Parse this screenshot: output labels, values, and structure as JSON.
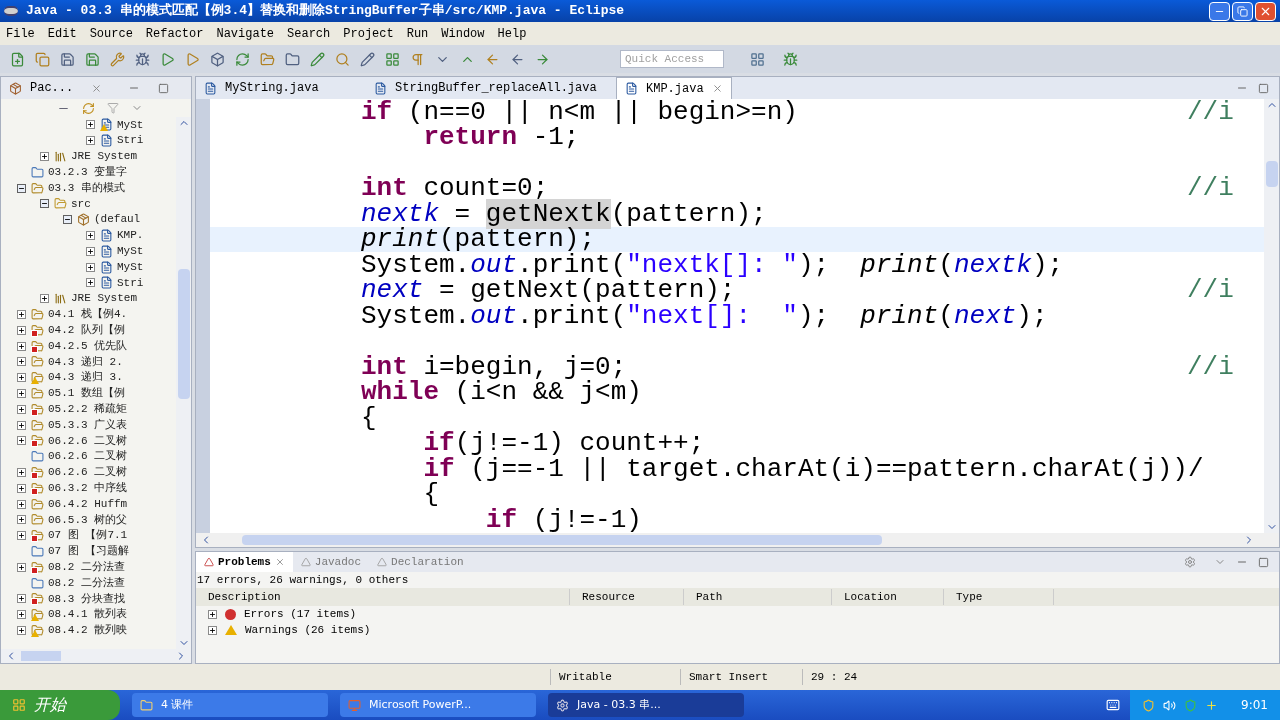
{
  "window": {
    "title": "Java - 03.3  串的模式匹配【例3.4】替换和删除StringBuffer子串/src/KMP.java - Eclipse"
  },
  "menu": [
    "File",
    "Edit",
    "Source",
    "Refactor",
    "Navigate",
    "Search",
    "Project",
    "Run",
    "Window",
    "Help"
  ],
  "quick_access": {
    "placeholder": "Quick Access"
  },
  "explorer": {
    "title": "Pac...",
    "tree": [
      {
        "children": [
          {
            "children": [
              {
                "children": [
                  {
                    "label": "MySt",
                    "kind": "file",
                    "expanded": false,
                    "error": false,
                    "warning": true
                  },
                  {
                    "label": "Stri",
                    "kind": "file",
                    "expanded": false,
                    "error": false,
                    "warning": false
                  }
                ]
              }
            ]
          },
          {
            "label": "JRE System",
            "kind": "library",
            "expanded": false,
            "error": false,
            "warning": false
          }
        ]
      },
      {
        "label": "03.2.3  变量字",
        "kind": "folder",
        "error": false,
        "warning": false
      },
      {
        "label": "03.3  串的模式",
        "kind": "project",
        "expanded": true,
        "error": false,
        "warning": false,
        "children": [
          {
            "label": "src",
            "kind": "source",
            "expanded": true,
            "error": false,
            "warning": false,
            "children": [
              {
                "label": "(defaul",
                "kind": "package",
                "expanded": true,
                "error": false,
                "warning": false,
                "children": [
                  {
                    "label": "KMP.",
                    "kind": "file",
                    "expanded": false,
                    "error": false,
                    "warning": false
                  },
                  {
                    "label": "MySt",
                    "kind": "file",
                    "expanded": false,
                    "error": false,
                    "warning": false
                  },
                  {
                    "label": "MySt",
                    "kind": "file",
                    "expanded": false,
                    "error": false,
                    "warning": false
                  },
                  {
                    "label": "Stri",
                    "kind": "file",
                    "expanded": false,
                    "error": false,
                    "warning": false
                  }
                ]
              }
            ]
          },
          {
            "label": "JRE System",
            "kind": "library",
            "expanded": false,
            "error": false,
            "warning": false
          }
        ]
      },
      {
        "label": "04.1  栈【例4.",
        "kind": "project",
        "expanded": false,
        "error": false,
        "warning": false
      },
      {
        "label": "04.2  队列【例",
        "kind": "project",
        "expanded": false,
        "error": true,
        "warning": false
      },
      {
        "label": "04.2.5  优先队",
        "kind": "project",
        "expanded": false,
        "error": true,
        "warning": false
      },
      {
        "label": "04.3  递归 2.",
        "kind": "project",
        "expanded": false,
        "error": false,
        "warning": false
      },
      {
        "label": "04.3  递归 3.",
        "kind": "project",
        "expanded": false,
        "error": false,
        "warning": true
      },
      {
        "label": "05.1  数组【例",
        "kind": "project",
        "expanded": false,
        "error": false,
        "warning": false
      },
      {
        "label": "05.2.2  稀疏矩",
        "kind": "project",
        "expanded": false,
        "error": true,
        "warning": false
      },
      {
        "label": "05.3.3  广义表",
        "kind": "project",
        "expanded": false,
        "error": false,
        "warning": false
      },
      {
        "label": "06.2.6  二叉树",
        "kind": "project",
        "expanded": false,
        "error": true,
        "warning": false
      },
      {
        "label": "06.2.6  二叉树",
        "kind": "folder",
        "error": false,
        "warning": false
      },
      {
        "label": "06.2.6  二叉树",
        "kind": "project",
        "expanded": false,
        "error": true,
        "warning": false
      },
      {
        "label": "06.3.2  中序线",
        "kind": "project",
        "expanded": false,
        "error": true,
        "warning": false
      },
      {
        "label": "06.4.2  Huffm",
        "kind": "project",
        "expanded": false,
        "error": false,
        "warning": false
      },
      {
        "label": "06.5.3  树的父",
        "kind": "project",
        "expanded": false,
        "error": false,
        "warning": false
      },
      {
        "label": "07  图 【例7.1",
        "kind": "project",
        "expanded": false,
        "error": true,
        "warning": false
      },
      {
        "label": "07 图 【习题解",
        "kind": "folder",
        "error": false,
        "warning": false
      },
      {
        "label": "08.2  二分法查",
        "kind": "project",
        "expanded": false,
        "error": true,
        "warning": false
      },
      {
        "label": "08.2  二分法查",
        "kind": "folder",
        "error": false,
        "warning": false
      },
      {
        "label": "08.3  分块查找",
        "kind": "project",
        "expanded": false,
        "error": true,
        "warning": false
      },
      {
        "label": "08.4.1  散列表",
        "kind": "project",
        "expanded": false,
        "error": false,
        "warning": true
      },
      {
        "label": "08.4.2  散列映",
        "kind": "project",
        "expanded": false,
        "error": false,
        "warning": true
      }
    ]
  },
  "editor_tabs": [
    {
      "label": "MyString.java",
      "selected": false
    },
    {
      "label": "StringBuffer_replaceAll.java",
      "selected": false
    },
    {
      "label": "KMP.java",
      "selected": true
    }
  ],
  "code": [
    {
      "current": false,
      "segments": [
        {
          "kind": "kw",
          "text": "if"
        },
        {
          "kind": "plain",
          "text": " (n==0 || n<m || begin>=n)"
        }
      ],
      "comment": "//i"
    },
    {
      "current": false,
      "segments": [
        {
          "kind": "kw",
          "text": "    return"
        },
        {
          "kind": "plain",
          "text": " -1;"
        }
      ]
    },
    {
      "current": false
    },
    {
      "current": false,
      "segments": [
        {
          "kind": "kw",
          "text": "int"
        },
        {
          "kind": "plain",
          "text": " count=0;"
        }
      ],
      "comment": "//i"
    },
    {
      "current": false,
      "segments": [
        {
          "kind": "field",
          "text": "nextk"
        },
        {
          "kind": "plain",
          "text": " = "
        },
        {
          "kind": "occurrence",
          "text": "getNextk"
        },
        {
          "kind": "plain",
          "text": "(pattern);"
        }
      ]
    },
    {
      "current": true,
      "segments": [
        {
          "kind": "static",
          "text": "print"
        },
        {
          "kind": "plain",
          "text": "(pattern);"
        }
      ]
    },
    {
      "current": false,
      "segments": [
        {
          "kind": "plain",
          "text": "System."
        },
        {
          "kind": "field",
          "text": "out"
        },
        {
          "kind": "plain",
          "text": ".print("
        },
        {
          "kind": "str",
          "text": "\"nextk[]: \""
        },
        {
          "kind": "plain",
          "text": ");  "
        },
        {
          "kind": "static",
          "text": "print"
        },
        {
          "kind": "plain",
          "text": "("
        },
        {
          "kind": "field",
          "text": "nextk"
        },
        {
          "kind": "plain",
          "text": ");"
        }
      ]
    },
    {
      "current": false,
      "segments": [
        {
          "kind": "field",
          "text": "next"
        },
        {
          "kind": "plain",
          "text": " = getNext(pattern);"
        }
      ],
      "comment": "//i"
    },
    {
      "current": false,
      "segments": [
        {
          "kind": "plain",
          "text": "System."
        },
        {
          "kind": "field",
          "text": "out"
        },
        {
          "kind": "plain",
          "text": ".print("
        },
        {
          "kind": "str",
          "text": "\"next[]:  \""
        },
        {
          "kind": "plain",
          "text": ");  "
        },
        {
          "kind": "static",
          "text": "print"
        },
        {
          "kind": "plain",
          "text": "("
        },
        {
          "kind": "field",
          "text": "next"
        },
        {
          "kind": "plain",
          "text": ");"
        }
      ]
    },
    {
      "current": false
    },
    {
      "current": false,
      "segments": [
        {
          "kind": "kw",
          "text": "int"
        },
        {
          "kind": "plain",
          "text": " i=begin, j=0;"
        }
      ],
      "comment": "//i"
    },
    {
      "current": false,
      "segments": [
        {
          "kind": "kw",
          "text": "while"
        },
        {
          "kind": "plain",
          "text": " (i<n && j<m)"
        }
      ]
    },
    {
      "current": false,
      "segments": [
        {
          "kind": "plain",
          "text": "{"
        }
      ]
    },
    {
      "current": false,
      "segments": [
        {
          "kind": "kw",
          "text": "    if"
        },
        {
          "kind": "plain",
          "text": "(j!=-1) count++;"
        }
      ]
    },
    {
      "current": false,
      "segments": [
        {
          "kind": "kw",
          "text": "    if"
        },
        {
          "kind": "plain",
          "text": " (j==-1 || target.charAt(i)==pattern.charAt(j))/"
        }
      ]
    },
    {
      "current": false,
      "segments": [
        {
          "kind": "plain",
          "text": "    {"
        }
      ]
    },
    {
      "current": false,
      "segments": [
        {
          "kind": "kw",
          "text": "        if"
        },
        {
          "kind": "plain",
          "text": " (j!=-1)"
        }
      ]
    }
  ],
  "problems": {
    "tabs": [
      {
        "label": "Problems",
        "selected": true
      },
      {
        "label": "Javadoc",
        "selected": false
      },
      {
        "label": "Declaration",
        "selected": false
      }
    ],
    "summary": "17 errors, 26 warnings, 0 others",
    "columns": [
      "Description",
      "Resource",
      "Path",
      "Location",
      "Type"
    ],
    "rows": [
      {
        "kind": "error",
        "label": "Errors (17 items)",
        "expanded": false
      },
      {
        "kind": "warning",
        "label": "Warnings (26 items)",
        "expanded": false
      }
    ]
  },
  "status_bar": [
    "Writable",
    "Smart Insert",
    "29 : 24"
  ],
  "taskbar": {
    "start": "开始",
    "tasks": [
      {
        "label": "4 课件",
        "kind": "folder",
        "selected": false
      },
      {
        "label": "Microsoft PowerP...",
        "kind": "powerpoint",
        "selected": false
      },
      {
        "label": "Java - 03.3  串...",
        "kind": "eclipse",
        "selected": true
      }
    ],
    "clock": "9:01"
  }
}
